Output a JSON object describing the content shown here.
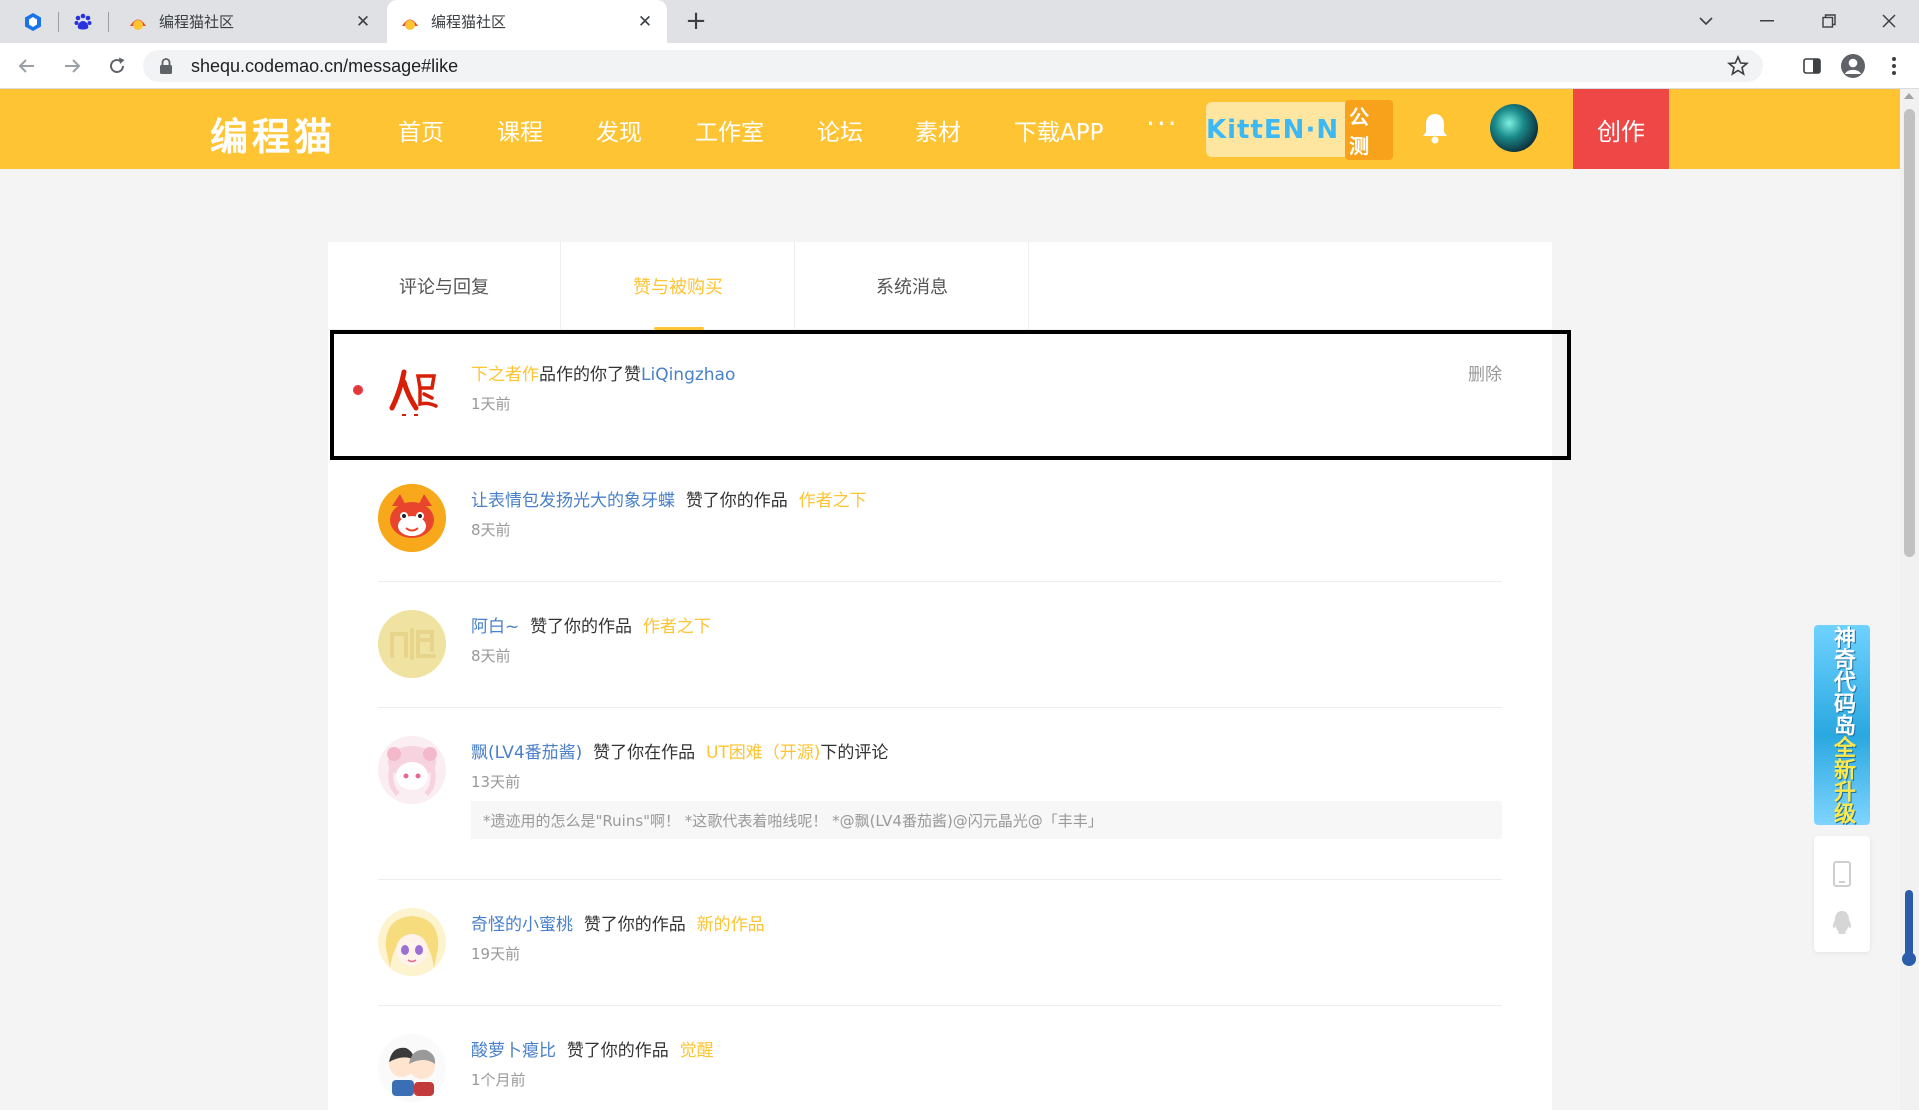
{
  "browser": {
    "tabs": [
      {
        "title": "编程猫社区",
        "active": false
      },
      {
        "title": "编程猫社区",
        "active": true
      }
    ],
    "url": "shequ.codemao.cn/message#like"
  },
  "site": {
    "logo": "编程猫",
    "nav": [
      "首页",
      "课程",
      "发现",
      "工作室",
      "论坛",
      "素材",
      "下载APP"
    ],
    "more": "···",
    "kitten_brand": "KittEN·N",
    "kitten_badge": "公测",
    "create_label": "创作"
  },
  "message_tabs": [
    "评论与回复",
    "赞与被购买",
    "系统消息"
  ],
  "messages": [
    {
      "prefix": "下之者作",
      "verb": "品作的你了赞",
      "user": "LiQingzhao",
      "time": "1天前",
      "delete": "删除"
    },
    {
      "user": "让表情包发扬光大的象牙蝶",
      "verb": "赞了你的作品",
      "work": "作者之下",
      "time": "8天前"
    },
    {
      "user": "阿白~",
      "verb": "赞了你的作品",
      "work": "作者之下",
      "time": "8天前"
    },
    {
      "user": "飘(LV4番茄酱)",
      "verb": "赞了你在作品",
      "work": "UT困难（开源)",
      "suffix": "下的评论",
      "time": "13天前",
      "quote": "*遗迹用的怎么是\"Ruins\"啊！ *这歌代表着啪线呢！ *@飘(LV4番茄酱)@闪元晶光@「丰丰」"
    },
    {
      "user": "奇怪的小蜜桃",
      "verb": "赞了你的作品",
      "work": "新的作品",
      "time": "19天前"
    },
    {
      "user": "酸萝卜瘪比",
      "verb": "赞了你的作品",
      "work": "觉醒",
      "time": "1个月前"
    }
  ],
  "side_widget": {
    "line1": "神奇代码岛",
    "line2": "全新升级"
  }
}
